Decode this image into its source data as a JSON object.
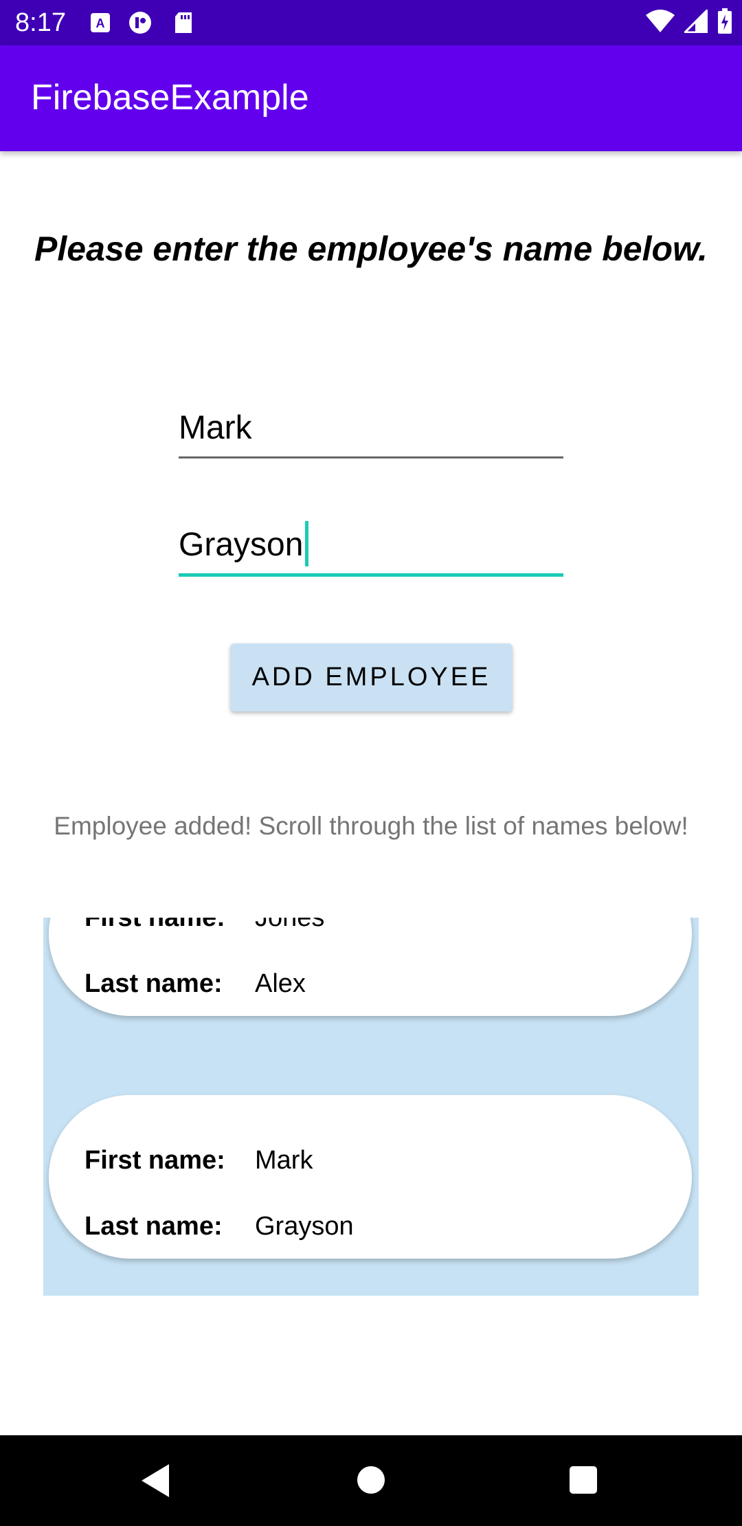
{
  "status_bar": {
    "time": "8:17",
    "icons_left": [
      "a-box-icon",
      "circle-logo-icon",
      "sd-card-icon"
    ],
    "icons_right": [
      "wifi-icon",
      "signal-icon",
      "battery-charging-icon"
    ]
  },
  "app_bar": {
    "title": "FirebaseExample",
    "color": "#6200ee"
  },
  "instruction": "Please enter the employee's name below.",
  "form": {
    "first_name_value": "Mark",
    "last_name_value": "Grayson",
    "accent_color": "#1ccbb5",
    "add_button_label": "ADD EMPLOYEE"
  },
  "message": "Employee added! Scroll through the list of names below!",
  "employees": [
    {
      "first_label": "First name:",
      "first": "Jones",
      "last_label": "Last name:",
      "last": "Alex"
    },
    {
      "first_label": "First name:",
      "first": "Mark",
      "last_label": "Last name:",
      "last": "Grayson"
    }
  ],
  "nav_bar": {
    "icons": [
      "back-icon",
      "home-icon",
      "recents-icon"
    ]
  }
}
